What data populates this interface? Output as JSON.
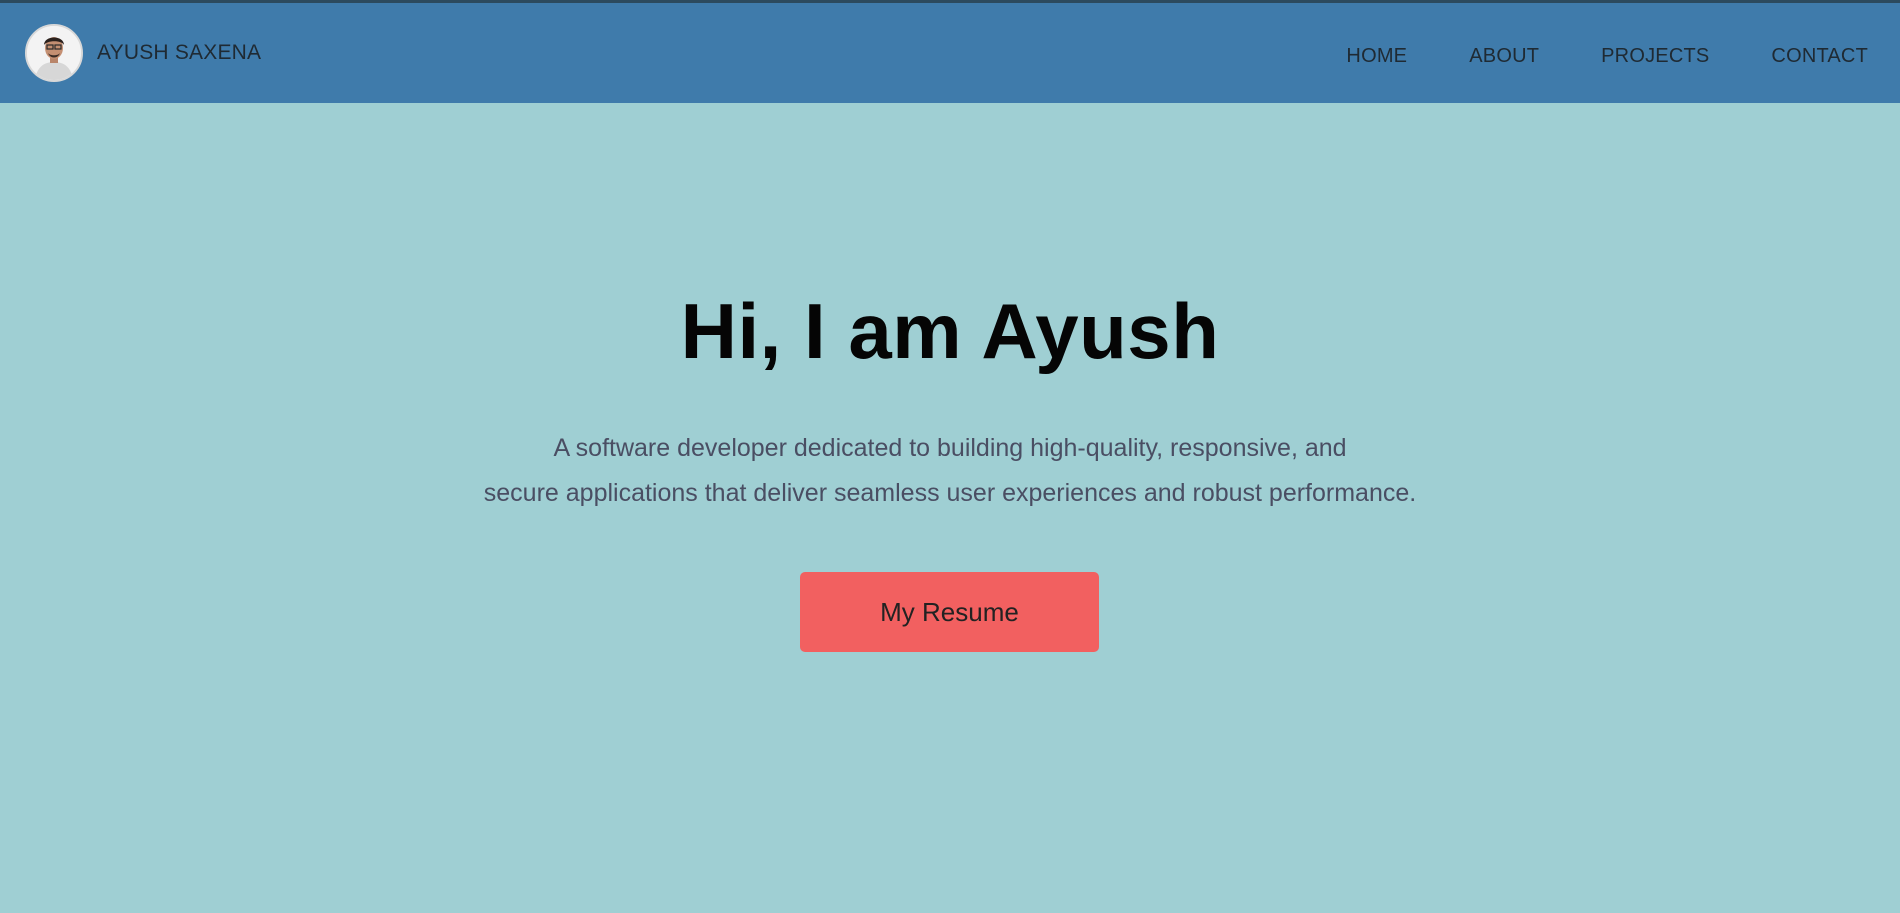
{
  "header": {
    "brand_name": "AYUSH SAXENA",
    "nav": [
      {
        "label": "HOME"
      },
      {
        "label": "ABOUT"
      },
      {
        "label": "PROJECTS"
      },
      {
        "label": "CONTACT"
      }
    ]
  },
  "hero": {
    "title": "Hi, I am Ayush",
    "description_line1": "A software developer dedicated to building high-quality, responsive, and",
    "description_line2": "secure applications that deliver seamless user experiences and robust performance.",
    "resume_button": "My Resume"
  },
  "colors": {
    "navbar": "#3f7bab",
    "background": "#9fcfd3",
    "button": "#f26060"
  },
  "icons": {
    "avatar": "profile-photo"
  }
}
